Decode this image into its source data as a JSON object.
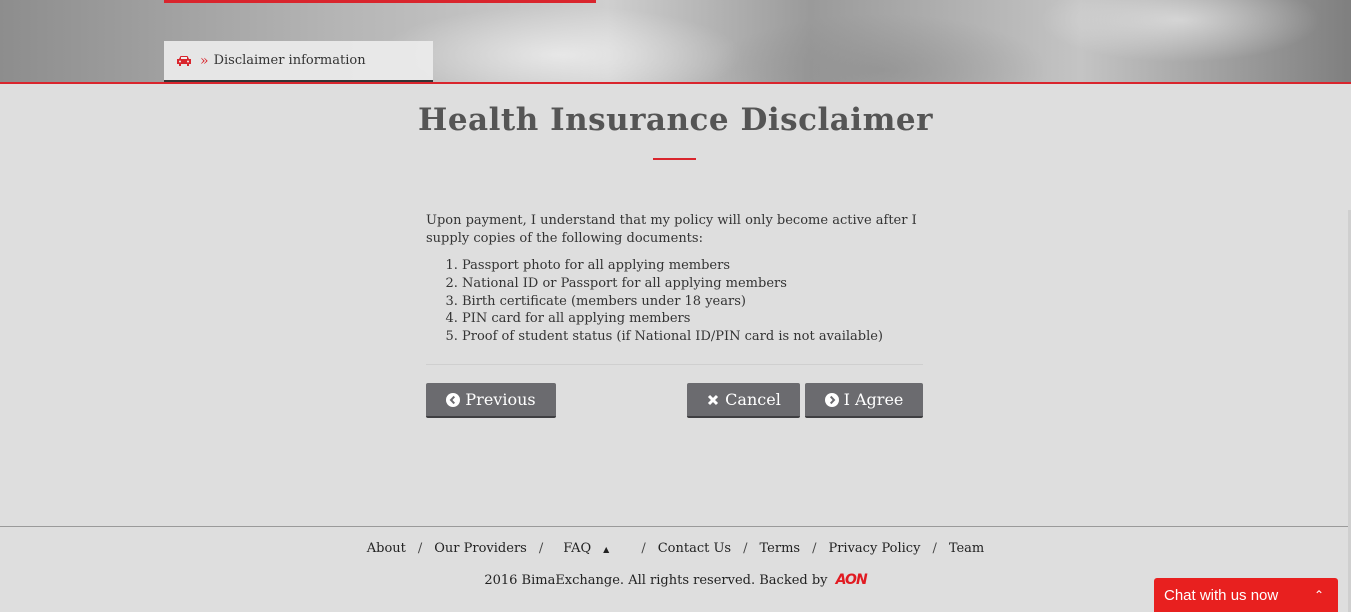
{
  "breadcrumb": {
    "icon": "car-icon",
    "separator": "»",
    "label": "Disclaimer information"
  },
  "page": {
    "title": "Health Insurance Disclaimer",
    "intro": "Upon payment, I understand that my policy will only become active after I supply copies of the following documents:",
    "documents": [
      "Passport photo for all applying members",
      "National ID or Passport for all applying members",
      "Birth certificate (members under 18 years)",
      "PIN card for all applying members",
      "Proof of student status (if National ID/PIN card is not available)"
    ]
  },
  "buttons": {
    "previous": "Previous",
    "cancel": "Cancel",
    "agree": "I Agree"
  },
  "footer": {
    "nav": {
      "about": "About",
      "providers": "Our Providers",
      "faq": "FAQ",
      "contact": "Contact Us",
      "terms": "Terms",
      "privacy": "Privacy Policy",
      "team": "Team",
      "separator": "/"
    },
    "copyright": "2016 BimaExchange. All rights reserved. Backed by",
    "backer_logo": "AON"
  },
  "chat": {
    "label": "Chat with us now",
    "toggle": "⌃"
  },
  "colors": {
    "accent": "#d9252d",
    "button": "#6b6b6f",
    "chat": "#e8201f",
    "background": "#dedede"
  }
}
